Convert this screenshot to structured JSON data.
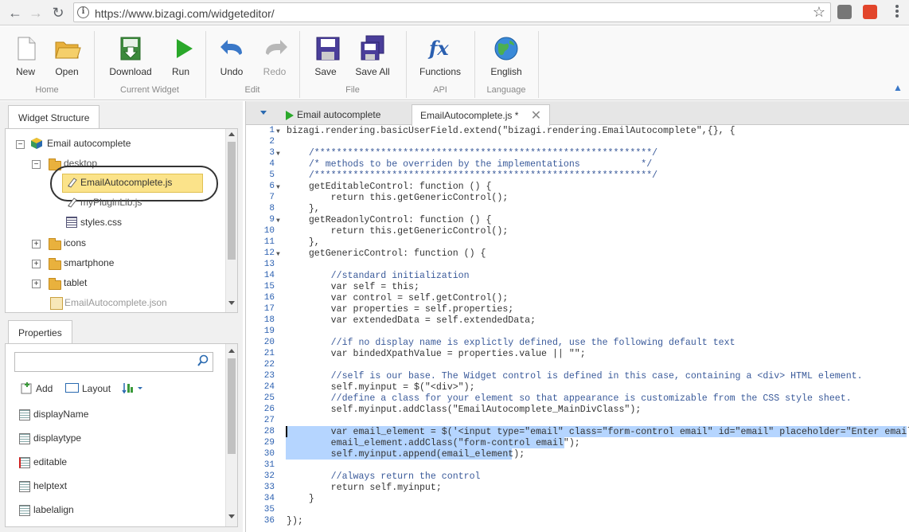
{
  "browser": {
    "url": "https://www.bizagi.com/widgeteditor/"
  },
  "ribbon": {
    "buttons": {
      "new": "New",
      "open": "Open",
      "download": "Download",
      "run": "Run",
      "undo": "Undo",
      "redo": "Redo",
      "save": "Save",
      "save_all": "Save All",
      "functions": "Functions",
      "english": "English"
    },
    "groups": {
      "home": "Home",
      "current_widget": "Current Widget",
      "edit": "Edit",
      "file": "File",
      "api": "API",
      "language": "Language"
    }
  },
  "widget_structure": {
    "tab": "Widget Structure",
    "items": [
      {
        "label": "Email autocomplete"
      },
      {
        "label": "desktop"
      },
      {
        "label": "EmailAutocomplete.js"
      },
      {
        "label": "myPluginLib.js"
      },
      {
        "label": "styles.css"
      },
      {
        "label": "icons"
      },
      {
        "label": "smartphone"
      },
      {
        "label": "tablet"
      },
      {
        "label": "EmailAutocomplete.json"
      }
    ]
  },
  "properties": {
    "tab": "Properties",
    "add": "Add",
    "layout": "Layout",
    "items": [
      "displayName",
      "displaytype",
      "editable",
      "helptext",
      "labelalign"
    ]
  },
  "editor": {
    "tabs": [
      "Email autocomplete",
      "EmailAutocomplete.js *"
    ],
    "lines": [
      "bizagi.rendering.basicUserField.extend(\"bizagi.rendering.EmailAutocomplete\",{}, {",
      "",
      "    /*************************************************************/",
      "    /* methods to be overriden by the implementations           */",
      "    /*************************************************************/",
      "    getEditableControl: function () {",
      "        return this.getGenericControl();",
      "    },",
      "    getReadonlyControl: function () {",
      "        return this.getGenericControl();",
      "    },",
      "    getGenericControl: function () {",
      "",
      "        //standard initialization",
      "        var self = this;",
      "        var control = self.getControl();",
      "        var properties = self.properties;",
      "        var extendedData = self.extendedData;",
      "",
      "        //if no display name is explictly defined, use the following default text",
      "        var bindedXpathValue = properties.value || \"\";",
      "",
      "        //self is our base. The Widget control is defined in this case, containing a <div> HTML element.",
      "        self.myinput = $(\"<div>\");",
      "        //define a class for your element so that appearance is customizable from the CSS style sheet.",
      "        self.myinput.addClass(\"EmailAutocomplete_MainDivClass\");",
      "",
      "        var email_element = $('<input type=\"email\" class=\"form-control email\" id=\"email\" placeholder=\"Enter email\">');",
      "        email_element.addClass(\"form-control email\");",
      "        self.myinput.append(email_element);",
      "",
      "        //always return the control",
      "        return self.myinput;",
      "    }",
      "",
      "});"
    ]
  }
}
